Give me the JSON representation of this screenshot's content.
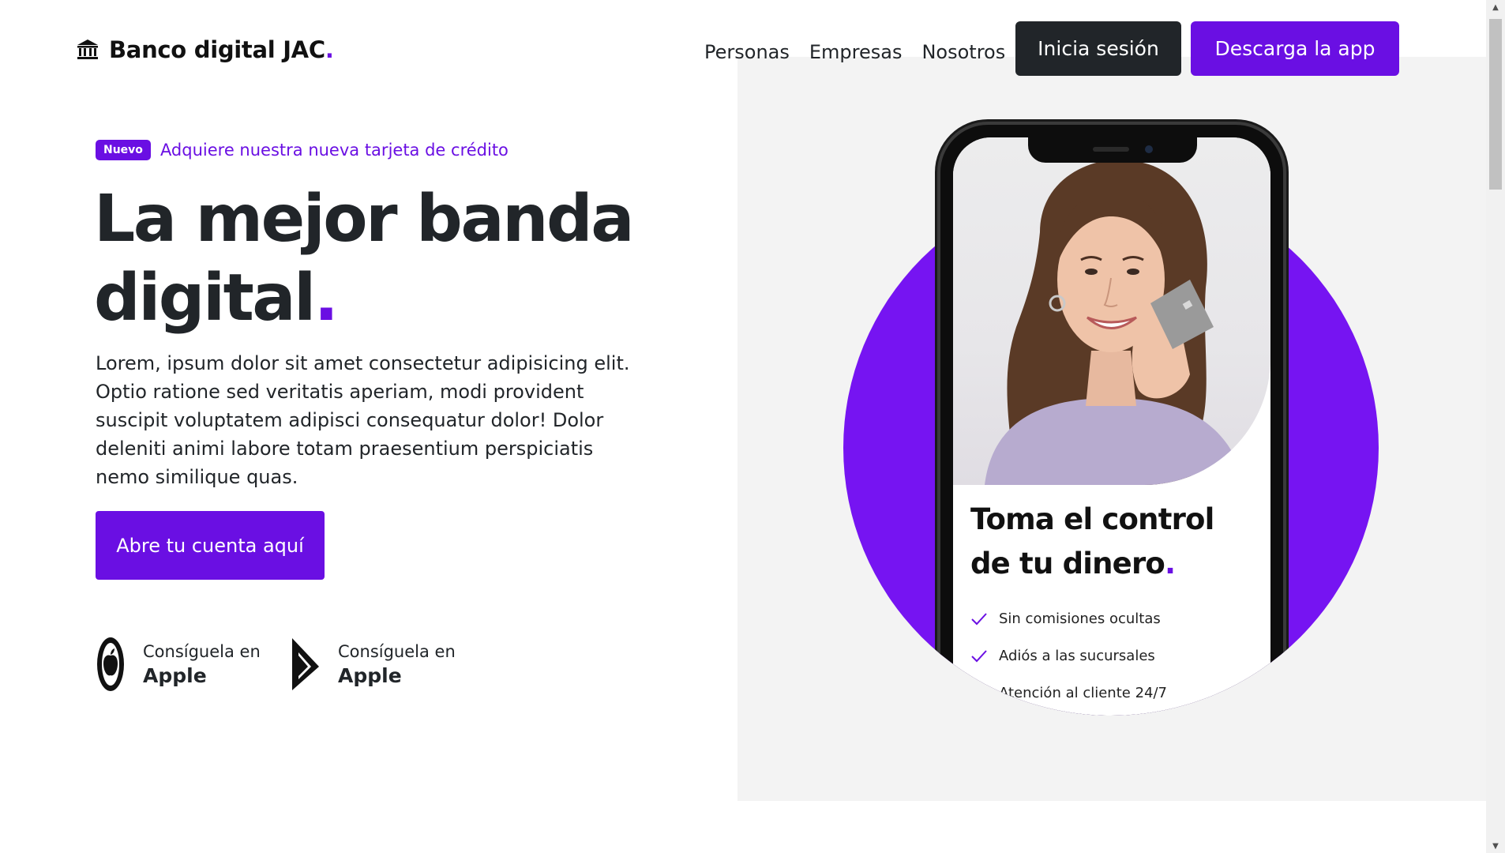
{
  "nav": {
    "brand": "Banco digital JAC",
    "brand_dot": ".",
    "brand_icon": "bank-icon",
    "links": [
      "Personas",
      "Empresas",
      "Nosotros"
    ],
    "login_label": "Inicia sesión",
    "download_label": "Descarga la app"
  },
  "hero": {
    "badge": "Nuevo",
    "promo_text": "Adquiere nuestra nueva tarjeta de crédito",
    "headline_line1": "La mejor banda",
    "headline_line2": "digital",
    "headline_dot": ".",
    "lead": "Lorem, ipsum dolor sit amet consectetur adipisicing elit. Optio ratione sed veritatis aperiam, modi provident suscipit voluptatem adipisci consequatur dolor! Dolor deleniti animi labore totam praesentium perspiciatis nemo similique quas.",
    "cta_label": "Abre tu cuenta aquí",
    "stores": [
      {
        "icon": "apple-icon",
        "pre": "Consíguela en",
        "name": "Apple"
      },
      {
        "icon": "play-store-icon",
        "pre": "Consíguela en",
        "name": "Apple"
      }
    ]
  },
  "phone": {
    "title_line1": "Toma el control",
    "title_line2": "de tu dinero",
    "title_dot": ".",
    "features": [
      "Sin comisiones ocultas",
      "Adiós a las sucursales",
      "Atención al cliente 24/7"
    ]
  },
  "colors": {
    "accent": "#6a0fe3",
    "circle": "#7614f2",
    "dark": "#212529",
    "panel": "#f3f3f3"
  }
}
